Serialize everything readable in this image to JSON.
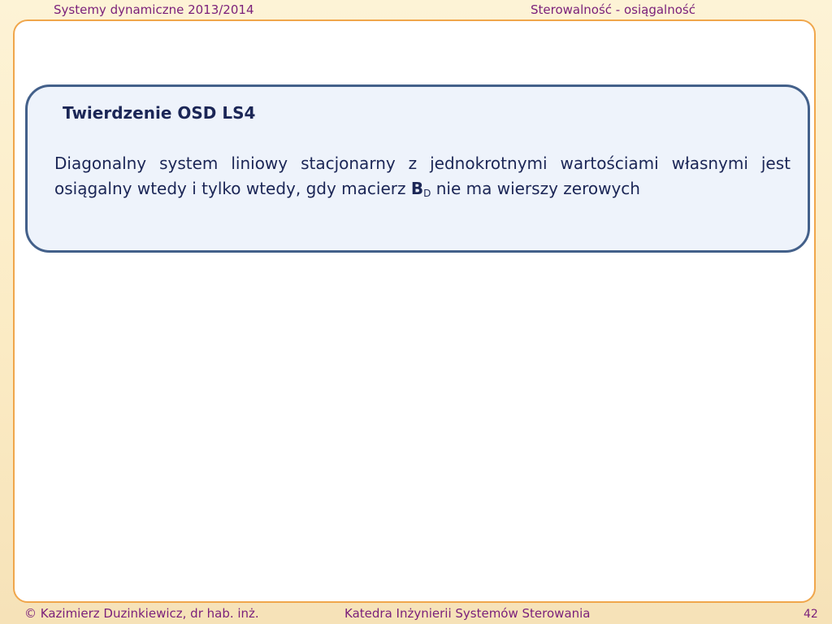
{
  "header": {
    "left": "Systemy dynamiczne 2013/2014",
    "right": "Sterowalność - osiągalność"
  },
  "theorem": {
    "title": "Twierdzenie OSD LS4",
    "text_before": "Diagonalny system liniowy stacjonarny z jednokrotnymi wartościami własnymi jest osiągalny wtedy i tylko wtedy, gdy macierz ",
    "matrix_symbol": "B",
    "matrix_subscript": "D",
    "text_after": " nie ma wierszy zerowych"
  },
  "footer": {
    "author": "© Kazimierz Duzinkiewicz, dr hab. inż.",
    "department": "Katedra Inżynierii Systemów Sterowania",
    "page_number": "42"
  },
  "colors": {
    "header_footer_text": "#7a1f7a",
    "slide_border": "#f0a64b",
    "theorem_border": "#43608a",
    "theorem_fill": "#eef3fb",
    "body_text": "#1b2656"
  }
}
